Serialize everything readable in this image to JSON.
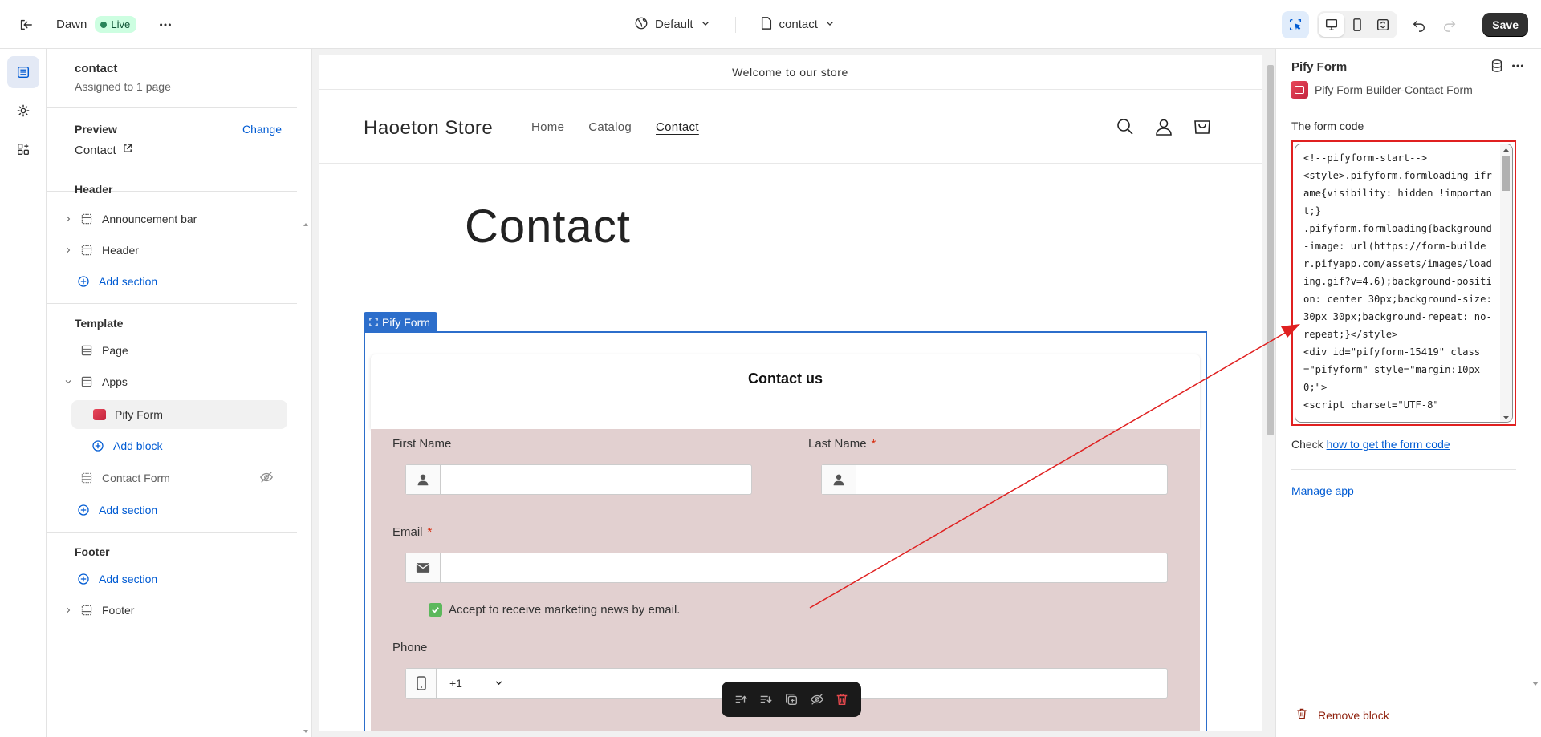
{
  "topbar": {
    "theme_name": "Dawn",
    "live_label": "Live",
    "view_dropdown": "Default",
    "page_dropdown": "contact",
    "save_label": "Save"
  },
  "left_panel": {
    "page_title": "contact",
    "page_sub": "Assigned to 1 page",
    "preview_label": "Preview",
    "change_label": "Change",
    "preview_value": "Contact",
    "header_section": "Header",
    "header_items": [
      "Announcement bar",
      "Header"
    ],
    "add_section": "Add section",
    "template_section": "Template",
    "template_items": [
      "Page",
      "Apps",
      "Pify Form"
    ],
    "add_block": "Add block",
    "contact_form": "Contact Form",
    "footer_section": "Footer",
    "footer_item": "Footer"
  },
  "store": {
    "announcement": "Welcome to our store",
    "name": "Haoeton Store",
    "nav": [
      "Home",
      "Catalog",
      "Contact"
    ],
    "page_heading": "Contact",
    "block_tag": "Pify Form"
  },
  "form": {
    "title": "Contact us",
    "first_name": "First Name",
    "last_name": "Last Name",
    "email": "Email",
    "required_mark": "*",
    "checkbox_label": "Accept to receive marketing news by email.",
    "phone": "Phone",
    "phone_code": "+1"
  },
  "right_panel": {
    "title": "Pify Form",
    "app_name": "Pify Form Builder-Contact Form",
    "code_label": "The form code",
    "code": "<!--pifyform-start-->\n<style>.pifyform.formloading iframe{visibility: hidden !important;}\n.pifyform.formloading{background-image: url(https://form-builder.pifyapp.com/assets/images/loading.gif?v=4.6);background-position: center 30px;background-size: 30px 30px;background-repeat: no-repeat;}</style>\n<div id=\"pifyform-15419\" class=\"pifyform\" style=\"margin:10px 0;\">\n<script charset=\"UTF-8\"",
    "check_prefix": "Check ",
    "check_link": "how to get the form code",
    "manage_app": "Manage app",
    "remove_block": "Remove block"
  },
  "colors": {
    "accent_blue": "#005bd3",
    "block_outline": "#2c6ecb",
    "form_bg": "#e2d0d0",
    "annotation_red": "#e02020",
    "live_badge_bg": "#cdfee1"
  }
}
